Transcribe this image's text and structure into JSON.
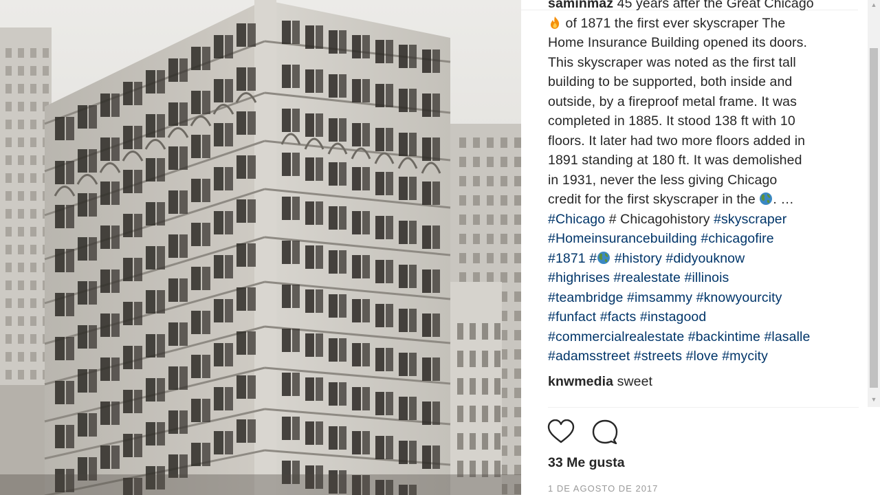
{
  "photo": {
    "description_icon": "vintage-skyscraper-photo"
  },
  "caption": {
    "username": "saminmaz",
    "lines": [
      {
        "parts": [
          {
            "t": "45 years after the Great Chicago",
            "k": "text"
          }
        ]
      },
      {
        "parts": [
          {
            "t": "fire-emoji",
            "k": "emoji"
          },
          {
            "t": " of 1871 the first ever skyscraper The",
            "k": "text"
          }
        ]
      },
      {
        "parts": [
          {
            "t": "Home Insurance Building opened its doors.",
            "k": "text"
          }
        ]
      },
      {
        "parts": [
          {
            "t": "This skyscraper was noted as the first tall",
            "k": "text"
          }
        ]
      },
      {
        "parts": [
          {
            "t": "building to be supported, both inside and",
            "k": "text"
          }
        ]
      },
      {
        "parts": [
          {
            "t": "outside, by a fireproof metal frame. It was",
            "k": "text"
          }
        ]
      },
      {
        "parts": [
          {
            "t": "completed in 1885. It stood 138 ft with 10",
            "k": "text"
          }
        ]
      },
      {
        "parts": [
          {
            "t": "floors. It later had two more floors added in",
            "k": "text"
          }
        ]
      },
      {
        "parts": [
          {
            "t": "1891 standing at 180 ft. It was demolished",
            "k": "text"
          }
        ]
      },
      {
        "parts": [
          {
            "t": "in 1931, never the less giving Chicago",
            "k": "text"
          }
        ]
      },
      {
        "parts": [
          {
            "t": "credit for the first skyscraper in the ",
            "k": "text"
          },
          {
            "t": "globe-emoji",
            "k": "emoji"
          },
          {
            "t": ". …",
            "k": "text"
          }
        ]
      },
      {
        "parts": [
          {
            "t": "#Chicago",
            "k": "tag"
          },
          {
            "t": " # Chicagohistory ",
            "k": "text"
          },
          {
            "t": "#skyscraper",
            "k": "tag"
          }
        ]
      },
      {
        "parts": [
          {
            "t": "#Homeinsurancebuilding",
            "k": "tag"
          },
          {
            "t": " ",
            "k": "text"
          },
          {
            "t": "#chicagofire",
            "k": "tag"
          }
        ]
      },
      {
        "parts": [
          {
            "t": "#1871",
            "k": "tag"
          },
          {
            "t": " ",
            "k": "text"
          },
          {
            "t": "#",
            "k": "tag"
          },
          {
            "t": "globe-emoji",
            "k": "emoji"
          },
          {
            "t": " ",
            "k": "text"
          },
          {
            "t": "#history",
            "k": "tag"
          },
          {
            "t": " ",
            "k": "text"
          },
          {
            "t": "#didyouknow",
            "k": "tag"
          }
        ]
      },
      {
        "parts": [
          {
            "t": "#highrises",
            "k": "tag"
          },
          {
            "t": " ",
            "k": "text"
          },
          {
            "t": "#realestate",
            "k": "tag"
          },
          {
            "t": " ",
            "k": "text"
          },
          {
            "t": "#illinois",
            "k": "tag"
          }
        ]
      },
      {
        "parts": [
          {
            "t": "#teambridge",
            "k": "tag"
          },
          {
            "t": " ",
            "k": "text"
          },
          {
            "t": "#imsammy",
            "k": "tag"
          },
          {
            "t": " ",
            "k": "text"
          },
          {
            "t": "#knowyourcity",
            "k": "tag"
          }
        ]
      },
      {
        "parts": [
          {
            "t": "#funfact",
            "k": "tag"
          },
          {
            "t": " ",
            "k": "text"
          },
          {
            "t": "#facts",
            "k": "tag"
          },
          {
            "t": " ",
            "k": "text"
          },
          {
            "t": "#instagood",
            "k": "tag"
          }
        ]
      },
      {
        "parts": [
          {
            "t": "#commercialrealestate",
            "k": "tag"
          },
          {
            "t": " ",
            "k": "text"
          },
          {
            "t": "#backintime",
            "k": "tag"
          },
          {
            "t": " ",
            "k": "text"
          },
          {
            "t": "#lasalle",
            "k": "tag"
          }
        ]
      },
      {
        "parts": [
          {
            "t": "#adamsstreet",
            "k": "tag"
          },
          {
            "t": " ",
            "k": "text"
          },
          {
            "t": "#streets",
            "k": "tag"
          },
          {
            "t": " ",
            "k": "text"
          },
          {
            "t": "#love",
            "k": "tag"
          },
          {
            "t": " ",
            "k": "text"
          },
          {
            "t": "#mycity",
            "k": "tag"
          }
        ]
      }
    ]
  },
  "comment": {
    "username": "knwmedia",
    "text": "sweet"
  },
  "actions": {
    "like_icon": "heart-icon",
    "comment_icon": "speech-bubble-icon"
  },
  "likes_text": "33 Me gusta",
  "date_text": "1 DE AGOSTO DE 2017",
  "colors": {
    "text": "#262626",
    "hashtag": "#003569",
    "muted": "#999999",
    "divider": "#efefef"
  }
}
